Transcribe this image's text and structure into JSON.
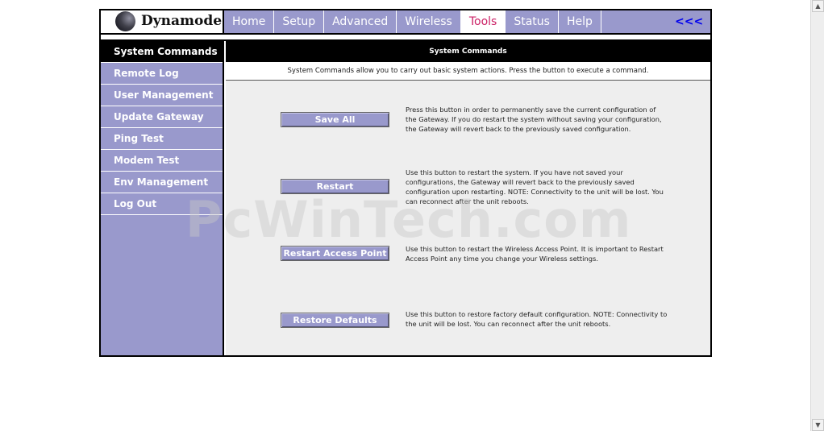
{
  "logo": {
    "text": "Dynamode"
  },
  "nav": {
    "items": [
      {
        "label": "Home"
      },
      {
        "label": "Setup"
      },
      {
        "label": "Advanced"
      },
      {
        "label": "Wireless"
      },
      {
        "label": "Tools"
      },
      {
        "label": "Status"
      },
      {
        "label": "Help"
      }
    ],
    "active": "Tools",
    "back_label": "<<<"
  },
  "sidebar": {
    "items": [
      {
        "label": "System Commands"
      },
      {
        "label": "Remote Log"
      },
      {
        "label": "User Management"
      },
      {
        "label": "Update Gateway"
      },
      {
        "label": "Ping Test"
      },
      {
        "label": "Modem Test"
      },
      {
        "label": "Env Management"
      },
      {
        "label": "Log Out"
      }
    ],
    "active": "System Commands"
  },
  "main": {
    "title": "System Commands",
    "intro": "System Commands allow you to carry out basic system actions. Press the button to execute a command.",
    "commands": [
      {
        "button": "Save All",
        "description": "Press this button in order to permanently save the current configuration of the Gateway. If you do restart the system without saving your configuration, the Gateway will revert back to the previously saved configuration."
      },
      {
        "button": "Restart",
        "description": "Use this button to restart the system. If you have not saved your configurations, the Gateway will revert back to the previously saved configuration upon restarting. NOTE: Connectivity to the unit will be lost. You can reconnect after the unit reboots."
      },
      {
        "button": "Restart Access Point",
        "description": "Use this button to restart the Wireless Access Point. It is important to Restart Access Point any time you change your Wireless settings."
      },
      {
        "button": "Restore Defaults",
        "description": "Use this button to restore factory default configuration. NOTE: Connectivity to the unit will be lost. You can reconnect after the unit reboots."
      }
    ]
  },
  "watermark": "PcWinTech.com",
  "colors": {
    "accent": "#9999cc",
    "active_tab_text": "#cc2266",
    "link": "#0000ee"
  },
  "icons": {
    "logo": "sphere-logo-icon",
    "scroll_up": "arrow-up-icon",
    "scroll_down": "arrow-down-icon"
  }
}
